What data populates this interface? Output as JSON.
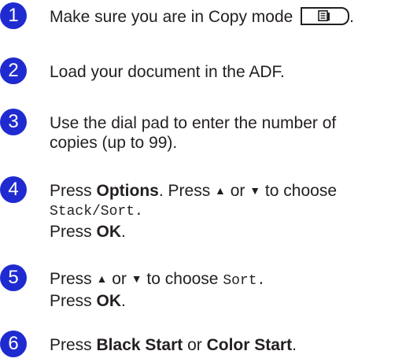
{
  "steps": [
    {
      "number": "1",
      "line1_text": "Make sure you are in Copy mode",
      "copy_key_icon": "copy-mode-key-icon"
    },
    {
      "number": "2",
      "text": "Load your document in the ADF."
    },
    {
      "number": "3",
      "line1": "Use the dial pad to enter the number of",
      "line2": "copies (up to 99)."
    },
    {
      "number": "4",
      "press": "Press ",
      "options": "Options",
      "press_up_down_prefix": ". Press ",
      "up_arrow": "▲",
      "or": " or ",
      "down_arrow": "▼",
      "to_choose": " to choose",
      "menu_value": "Stack/Sort.",
      "press_ok_prefix": "Press ",
      "ok": "OK",
      "period": "."
    },
    {
      "number": "5",
      "press": "Press ",
      "up_arrow": "▲",
      "or": " or ",
      "down_arrow": "▼",
      "to_choose": " to choose ",
      "menu_value": "Sort.",
      "press_ok_prefix": "Press ",
      "ok": "OK",
      "period": "."
    },
    {
      "number": "6",
      "press": "Press ",
      "black_start": "Black Start",
      "or": " or ",
      "color_start": "Color Start",
      "period": "."
    }
  ],
  "colors": {
    "badge": "#1f2bd0",
    "text": "#231f20"
  }
}
